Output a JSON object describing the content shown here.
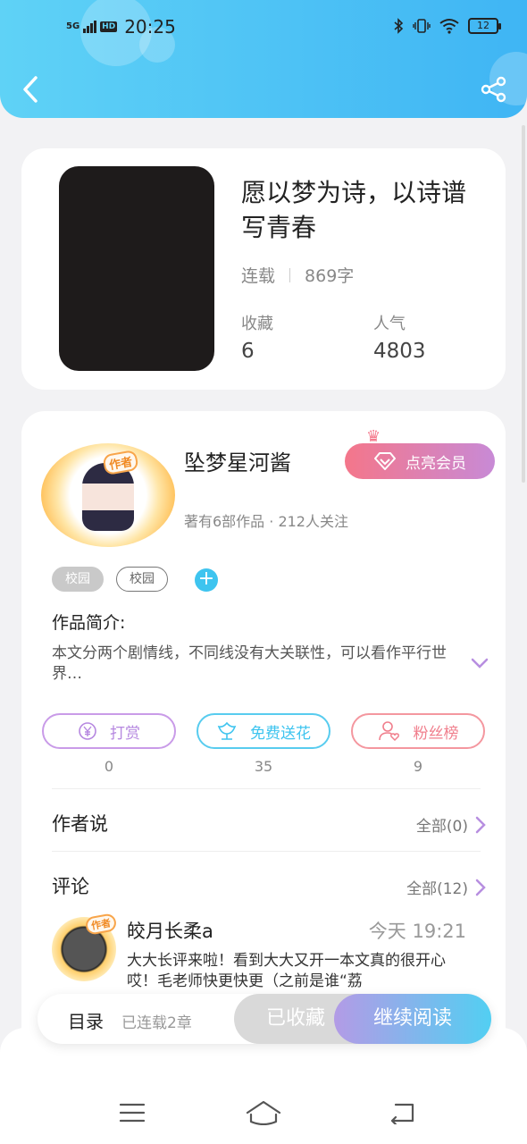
{
  "status_bar": {
    "network": "5G",
    "hd": "HD",
    "time": "20:25",
    "battery": "12"
  },
  "header": {
    "back_icon": "chevron-left-icon",
    "share_icon": "share-icon"
  },
  "book": {
    "title": "愿以梦为诗，以诗谱写青春",
    "status": "连载",
    "word_count": "869字",
    "favorites_label": "收藏",
    "favorites_value": "6",
    "popularity_label": "人气",
    "popularity_value": "4803"
  },
  "author": {
    "badge": "作者",
    "name": "坠梦星河酱",
    "meta": "著有6部作品 · 212人关注",
    "vip_label": "点亮会员"
  },
  "tags": [
    "校园",
    "校园"
  ],
  "intro": {
    "label": "作品简介:",
    "text": "本文分两个剧情线，不同线没有大关联性，可以看作平行世界…"
  },
  "actions": [
    {
      "label": "打赏",
      "count": "0",
      "icon": "yuan-icon"
    },
    {
      "label": "免费送花",
      "count": "35",
      "icon": "flower-icon"
    },
    {
      "label": "粉丝榜",
      "count": "9",
      "icon": "fans-icon"
    }
  ],
  "author_says": {
    "title": "作者说",
    "more": "全部(0)"
  },
  "comments": {
    "title": "评论",
    "more": "全部(12)",
    "items": [
      {
        "badge": "作者",
        "user": "皎月长柔a",
        "time": "今天 19:21",
        "text": "大大长评来啦！看到大大又开一本文真的很开心哎！毛老师快更快更（之前是谁“荔"
      }
    ]
  },
  "bottom_bar": {
    "toc": "目录",
    "progress": "已连载2章",
    "collected": "已收藏",
    "continue": "继续阅读"
  },
  "colors": {
    "header": "#4fc3f5",
    "accent_cyan": "#3ec4ef",
    "accent_pink": "#f4768a",
    "accent_purple": "#b688e0"
  }
}
